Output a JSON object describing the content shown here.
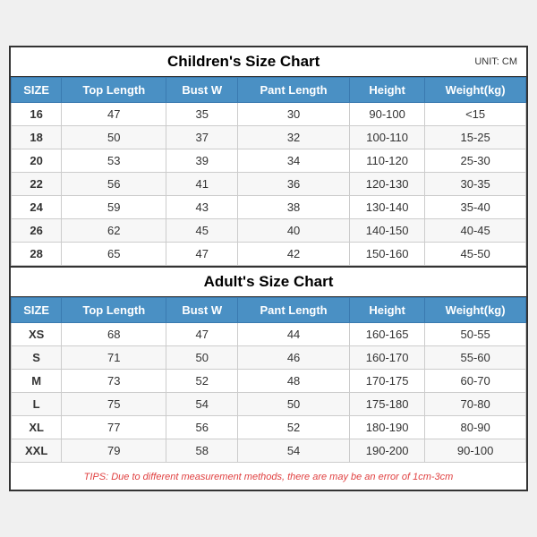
{
  "children": {
    "title": "Children's Size Chart",
    "unit": "UNIT: CM",
    "headers": [
      "SIZE",
      "Top Length",
      "Bust W",
      "Pant Length",
      "Height",
      "Weight(kg)"
    ],
    "rows": [
      [
        "16",
        "47",
        "35",
        "30",
        "90-100",
        "<15"
      ],
      [
        "18",
        "50",
        "37",
        "32",
        "100-110",
        "15-25"
      ],
      [
        "20",
        "53",
        "39",
        "34",
        "110-120",
        "25-30"
      ],
      [
        "22",
        "56",
        "41",
        "36",
        "120-130",
        "30-35"
      ],
      [
        "24",
        "59",
        "43",
        "38",
        "130-140",
        "35-40"
      ],
      [
        "26",
        "62",
        "45",
        "40",
        "140-150",
        "40-45"
      ],
      [
        "28",
        "65",
        "47",
        "42",
        "150-160",
        "45-50"
      ]
    ]
  },
  "adult": {
    "title": "Adult's Size Chart",
    "headers": [
      "SIZE",
      "Top Length",
      "Bust W",
      "Pant Length",
      "Height",
      "Weight(kg)"
    ],
    "rows": [
      [
        "XS",
        "68",
        "47",
        "44",
        "160-165",
        "50-55"
      ],
      [
        "S",
        "71",
        "50",
        "46",
        "160-170",
        "55-60"
      ],
      [
        "M",
        "73",
        "52",
        "48",
        "170-175",
        "60-70"
      ],
      [
        "L",
        "75",
        "54",
        "50",
        "175-180",
        "70-80"
      ],
      [
        "XL",
        "77",
        "56",
        "52",
        "180-190",
        "80-90"
      ],
      [
        "XXL",
        "79",
        "58",
        "54",
        "190-200",
        "90-100"
      ]
    ]
  },
  "tips": "TIPS: Due to different measurement methods, there are may be an error of 1cm-3cm"
}
